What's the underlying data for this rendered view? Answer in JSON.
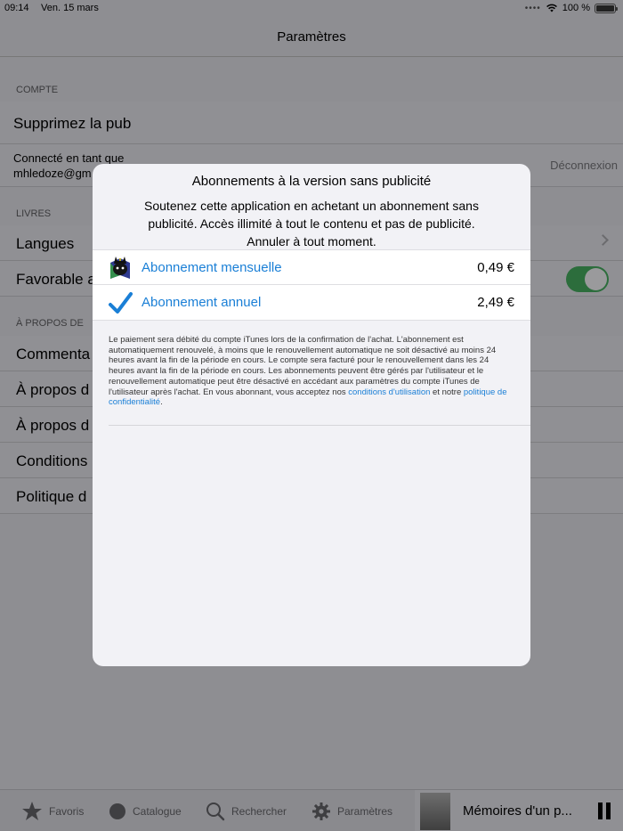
{
  "status_bar": {
    "time": "09:14",
    "date": "Ven. 15 mars",
    "battery": "100 %"
  },
  "nav": {
    "title": "Paramètres"
  },
  "settings": {
    "compte_header": "COMPTE",
    "remove_ads": "Supprimez la pub",
    "connected_as": "Connecté en tant que",
    "email": "mhledoze@gm",
    "logout": "Déconnexion",
    "livres_header": "LIVRES",
    "languages": "Langues",
    "favorable": "Favorable a",
    "favorable_on": true,
    "about_header": "À PROPOS DE",
    "comments": "Commenta",
    "about1": "À propos d",
    "about2": "À propos d",
    "conditions": "Conditions",
    "politique": "Politique d"
  },
  "modal": {
    "title": "Abonnements à la version sans publicité",
    "description": "Soutenez cette application en achetant un abonnement sans publicité. Accès illimité à tout le contenu et pas de publicité. Annuler à tout moment.",
    "plans": [
      {
        "name": "Abonnement mensuelle",
        "price": "0,49 €",
        "icon": "app-logo-icon"
      },
      {
        "name": "Abonnement annuel",
        "price": "2,49 €",
        "icon": "checkmark-icon"
      }
    ],
    "legal_text": "Le paiement sera débité du compte iTunes lors de la confirmation de l'achat. L'abonnement est automatiquement renouvelé, à moins que le renouvellement automatique ne soit désactivé au moins 24 heures avant la fin de la période en cours. Le compte sera facturé pour le renouvellement dans les 24 heures avant la fin de la période en cours. Les abonnements peuvent être gérés par l'utilisateur et le renouvellement automatique peut être désactivé en accédant aux paramètres du compte iTunes de l'utilisateur après l'achat. En vous abonnant, vous acceptez nos",
    "terms_link": "conditions d'utilisation",
    "legal_and": "et notre",
    "privacy_link": "politique de confidentialité",
    "legal_end": ".",
    "link_color": "#1a7fd6"
  },
  "tabbar": {
    "tabs": [
      {
        "label": "Favoris",
        "icon": "star-icon"
      },
      {
        "label": "Catalogue",
        "icon": "circle-icon"
      },
      {
        "label": "Rechercher",
        "icon": "search-icon"
      },
      {
        "label": "Paramètres",
        "icon": "gear-icon"
      }
    ],
    "now_playing": "Mémoires d'un p..."
  }
}
